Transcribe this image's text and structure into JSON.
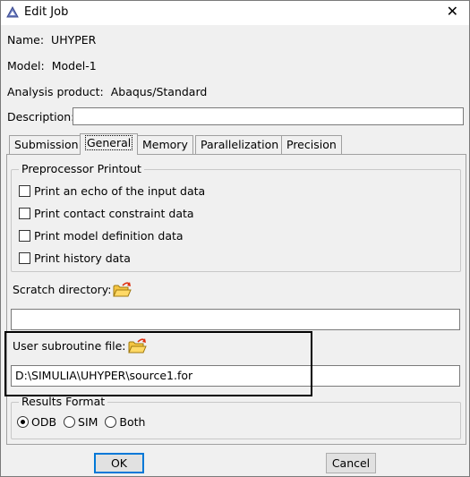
{
  "window": {
    "title": "Edit Job",
    "close_symbol": "✕"
  },
  "job": {
    "name_label": "Name:",
    "name_value": "UHYPER",
    "model_label": "Model:",
    "model_value": "Model-1",
    "product_label": "Analysis product:",
    "product_value": "Abaqus/Standard",
    "description_label": "Description:",
    "description_value": ""
  },
  "tabs": [
    {
      "label": "Submission"
    },
    {
      "label": "General"
    },
    {
      "label": "Memory"
    },
    {
      "label": "Parallelization"
    },
    {
      "label": "Precision"
    }
  ],
  "active_tab": "General",
  "general": {
    "printout_group_label": "Preprocessor Printout",
    "printout_options": [
      {
        "label": "Print an echo of the input data",
        "checked": false
      },
      {
        "label": "Print contact constraint data",
        "checked": false
      },
      {
        "label": "Print model definition data",
        "checked": false
      },
      {
        "label": "Print history data",
        "checked": false
      }
    ],
    "scratch_label": "Scratch directory:",
    "scratch_value": "",
    "subroutine_label": "User subroutine file:",
    "subroutine_value": "D:\\SIMULIA\\UHYPER\\source1.for",
    "results_group_label": "Results Format",
    "results_options": [
      {
        "label": "ODB",
        "selected": true
      },
      {
        "label": "SIM",
        "selected": false
      },
      {
        "label": "Both",
        "selected": false
      }
    ]
  },
  "buttons": {
    "ok": "OK",
    "cancel": "Cancel"
  },
  "icons": {
    "app": "abaqus-triangle-icon",
    "folder": "open-folder-icon"
  },
  "colors": {
    "folder_yellow": "#f5c542",
    "folder_arrow": "#e03010",
    "default_button_border": "#0078d7"
  }
}
